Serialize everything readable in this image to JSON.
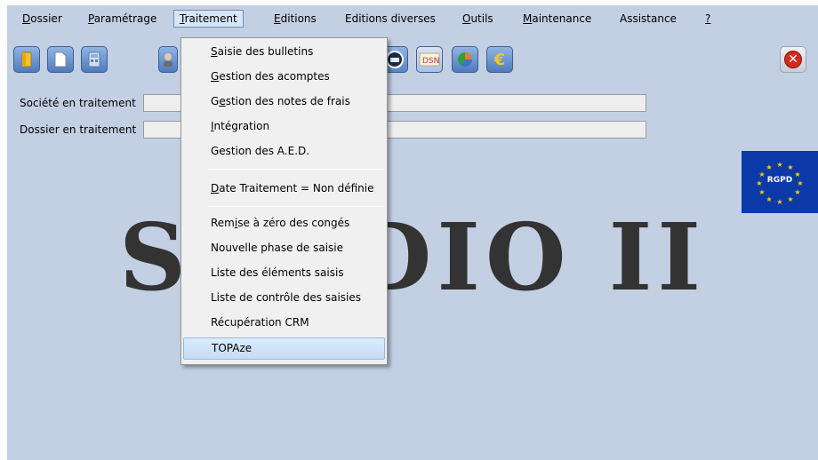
{
  "menubar": {
    "items": [
      {
        "label": "Dossier",
        "mnemonic": "D",
        "rest": "ossier"
      },
      {
        "label": "Paramétrage",
        "mnemonic": "P",
        "rest": "aramétrage"
      },
      {
        "label": "Traitement",
        "mnemonic": "T",
        "rest": "raitement"
      },
      {
        "label": "Editions",
        "mnemonic": "E",
        "rest": "ditions"
      },
      {
        "label": "Editions diverses",
        "mnemonic": "",
        "rest": "Editions diverses"
      },
      {
        "label": "Outils",
        "mnemonic": "O",
        "rest": "utils"
      },
      {
        "label": "Maintenance",
        "mnemonic": "M",
        "rest": "aintenance"
      },
      {
        "label": "Assistance",
        "mnemonic": "",
        "rest": "Assistance"
      },
      {
        "label": "?",
        "mnemonic": "?",
        "rest": ""
      }
    ]
  },
  "toolbar": {
    "icons": [
      "folder-icon",
      "document-icon",
      "calculator-icon",
      "user-icon",
      "scanner-icon",
      "dsn-icon",
      "chart-icon",
      "euro-icon"
    ],
    "euro_symbol": "€",
    "close_symbol": "✕"
  },
  "form": {
    "societe_label": "Société en traitement",
    "dossier_label": "Dossier en traitement",
    "societe_value": "",
    "dossier_value": ""
  },
  "brand": {
    "title": "STUDIO II"
  },
  "rgpd": {
    "label": "RGPD"
  },
  "dropdown": {
    "items": [
      {
        "label": "Saisie des bulletins",
        "mnemonic": "S",
        "rest": "aisie des bulletins"
      },
      {
        "label": "Gestion des acomptes",
        "mnemonic": "G",
        "rest": "estion des acomptes"
      },
      {
        "label": "Gestion des notes de frais",
        "pre": "G",
        "mnemonic": "e",
        "rest": "stion des notes de frais"
      },
      {
        "label": "Intégration",
        "mnemonic": "I",
        "rest": "ntégration"
      },
      {
        "label": "Gestion des A.E.D.",
        "mnemonic": "",
        "rest": "Gestion des A.E.D."
      },
      {
        "label": "Date Traitement = Non définie",
        "mnemonic": "D",
        "rest": "ate Traitement = Non définie"
      },
      {
        "label": "Remise à zéro des congés",
        "pre": "Rem",
        "mnemonic": "i",
        "rest": "se à zéro des congés"
      },
      {
        "label": "Nouvelle phase de saisie",
        "mnemonic": "",
        "rest": "Nouvelle phase de saisie"
      },
      {
        "label": "Liste des éléments saisis",
        "mnemonic": "",
        "rest": "Liste des éléments saisis"
      },
      {
        "label": "Liste de contrôle des saisies",
        "mnemonic": "",
        "rest": "Liste de contrôle des saisies"
      },
      {
        "label": "Récupération CRM",
        "mnemonic": "",
        "rest": "Récupération CRM"
      },
      {
        "label": "TOPAze",
        "mnemonic": "",
        "rest": "TOPAze"
      }
    ],
    "highlighted": "TOPAze"
  },
  "colors": {
    "background": "#c3cfe3",
    "menu_bg": "#f0f0f0",
    "highlight": "#c3dcf5",
    "rgpd_blue": "#0b3aa8"
  }
}
